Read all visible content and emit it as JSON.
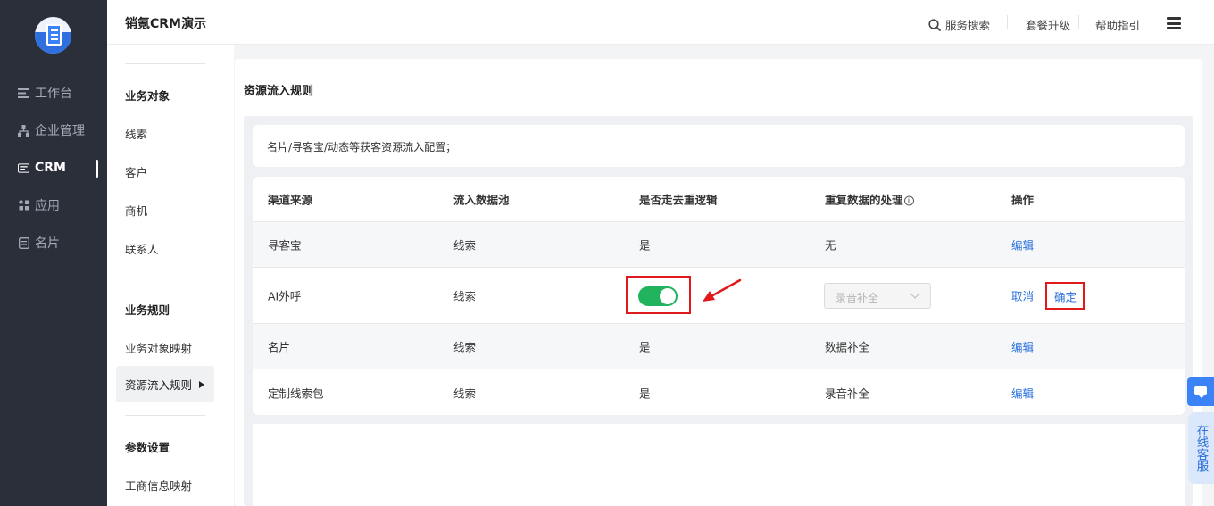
{
  "nav": {
    "items": [
      {
        "label": "工作台",
        "icon": "workbench-icon"
      },
      {
        "label": "企业管理",
        "icon": "org-icon"
      },
      {
        "label": "CRM",
        "icon": "crm-icon",
        "active": true
      },
      {
        "label": "应用",
        "icon": "apps-icon"
      },
      {
        "label": "名片",
        "icon": "card-icon"
      }
    ]
  },
  "header": {
    "title": "销氪CRM演示",
    "search": "服务搜索",
    "upgrade": "套餐升级",
    "help": "帮助指引"
  },
  "submenu": {
    "section1": "业务对象",
    "s1_items": [
      "线索",
      "客户",
      "商机",
      "联系人"
    ],
    "section2": "业务规则",
    "s2_items": [
      "业务对象映射",
      "资源流入规则"
    ],
    "section3": "参数设置",
    "s3_items": [
      "工商信息映射"
    ]
  },
  "main": {
    "title": "资源流入规则",
    "description": "名片/寻客宝/动态等获客资源流入配置；",
    "columns": [
      "渠道来源",
      "流入数据池",
      "是否走去重逻辑",
      "重复数据的处理",
      "操作"
    ],
    "rows": [
      {
        "source": "寻客宝",
        "pool": "线索",
        "dedupe": "是",
        "handling": "无",
        "action": "编辑"
      },
      {
        "source": "AI外呼",
        "pool": "线索",
        "dedupe_on": true,
        "select_placeholder": "录音补全",
        "cancel": "取消",
        "confirm": "确定"
      },
      {
        "source": "名片",
        "pool": "线索",
        "dedupe": "是",
        "handling": "数据补全",
        "action": "编辑"
      },
      {
        "source": "定制线索包",
        "pool": "线索",
        "dedupe": "是",
        "handling": "录音补全",
        "action": "编辑"
      }
    ]
  },
  "float": {
    "kefu": "在线客服"
  },
  "colors": {
    "nav_bg": "#2b2f3a",
    "accent": "#2a6fdb",
    "toggle_on": "#22b35e",
    "highlight": "#e0191c"
  }
}
